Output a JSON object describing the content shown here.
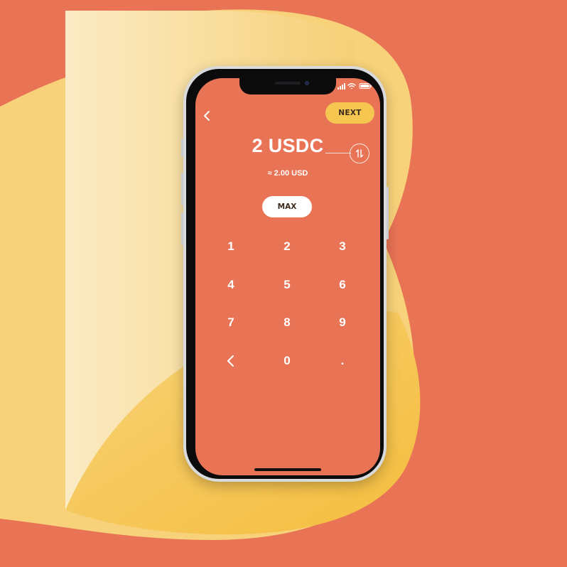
{
  "colors": {
    "background": "#E97355",
    "shape_yellow": "#F6C750",
    "shape_light": "#F9E3AE",
    "screen": "#E97355",
    "next_button": "#F6C750",
    "max_button": "#FFFFFF",
    "text_on_orange": "#FFFFFF",
    "dark_text": "#3B2B1F"
  },
  "header": {
    "back_icon": "chevron-left-icon",
    "next_label": "NEXT"
  },
  "amount": {
    "primary": "2 USDC",
    "secondary": "≈ 2.00 USD",
    "swap_icon": "swap-arrows-icon"
  },
  "max_label": "MAX",
  "keypad": {
    "keys": [
      "1",
      "2",
      "3",
      "4",
      "5",
      "6",
      "7",
      "8",
      "9",
      "",
      "0",
      "."
    ],
    "backspace_icon": "chevron-left-icon"
  },
  "status_bar": {
    "icons": [
      "signal-icon",
      "wifi-icon",
      "battery-icon"
    ]
  }
}
